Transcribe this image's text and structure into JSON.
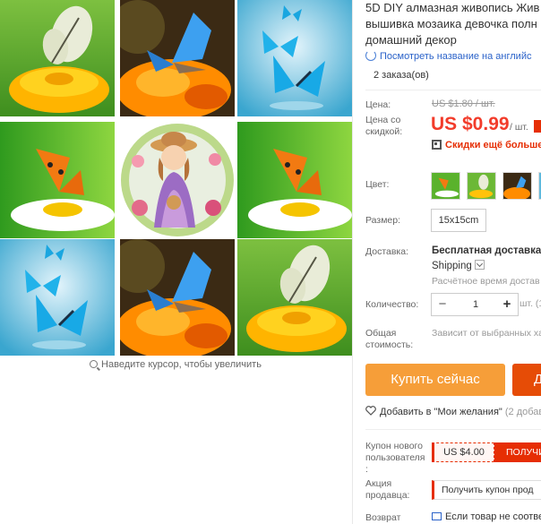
{
  "gallery": {
    "zoom_hint": "Наведите курсор, чтобы увеличить"
  },
  "product": {
    "title_lines": [
      "5D DIY алмазная живопись Жив",
      "вышивка мозаика девочка полн",
      "домашний декор"
    ],
    "translate_link": "Посмотреть название на английс",
    "orders": "2 заказа(ов)"
  },
  "pricing": {
    "price_label": "Цена:",
    "original_price": "US $1.80 / шт.",
    "discount_label_1": "Цена со",
    "discount_label_2": "скидкой:",
    "price": "US $0.99",
    "unit": "/ шт.",
    "coupon_promo": "Скидки ещё больше в"
  },
  "options": {
    "color_label": "Цвет:",
    "size_label": "Размер:",
    "size_value": "15x15cm",
    "shipping_label": "Доставка:",
    "shipping_free": "Бесплатная доставка в",
    "shipping_method": "Shipping",
    "shipping_time": "Расчётное время достав",
    "qty_label": "Количество:",
    "qty_minus": "−",
    "qty_value": "1",
    "qty_plus": "+",
    "qty_unit": "шт. (1",
    "total_label_1": "Общая",
    "total_label_2": "стоимость:",
    "total_value": "Зависит от выбранных хa"
  },
  "actions": {
    "buy_now": "Купить сейчас",
    "add_to_cart": "Д",
    "wishlist": "Добавить в \"Мои желания\"",
    "wishlist_count": "(2 добав"
  },
  "coupons": {
    "new_user_label_1": "Купон нового",
    "new_user_label_2": "пользователя",
    "new_user_label_3": ":",
    "new_user_amount": "US $4.00",
    "new_user_button": "ПОЛУЧИ",
    "seller_label_1": "Акция",
    "seller_label_2": "продавца:",
    "seller_button": "Получить купон прод",
    "return_label": "Возврат",
    "return_text": "Если товар не соотве"
  },
  "colors": {
    "price_red": "#f23c2b",
    "buy_orange": "#f69e39",
    "cart_red": "#e64c06",
    "link_blue": "#2a62c9"
  }
}
